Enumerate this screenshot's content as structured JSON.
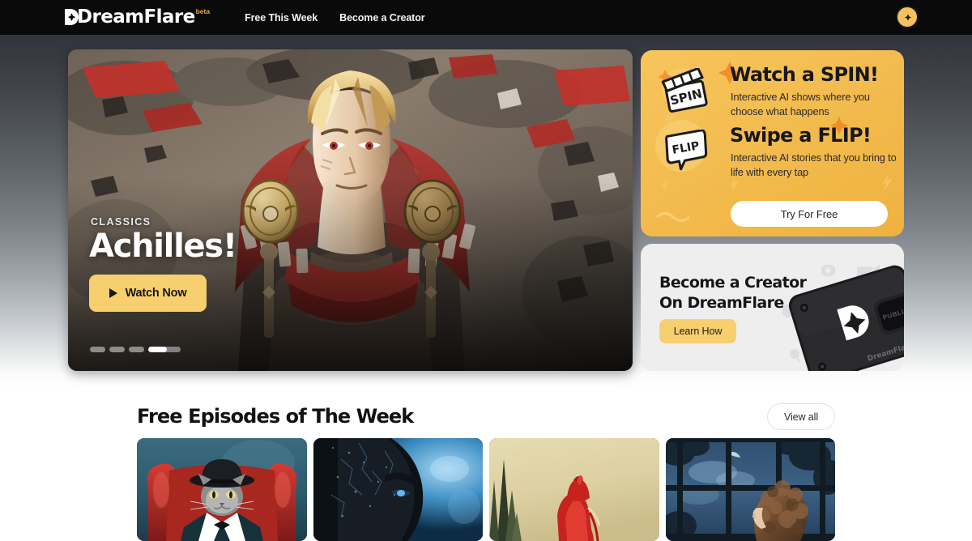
{
  "nav": {
    "logo_text": "DreamFlare",
    "logo_badge": "beta",
    "logo_icon": "dreamflare-flare-icon",
    "links": [
      {
        "label": "Free This Week"
      },
      {
        "label": "Become a Creator"
      }
    ],
    "avatar_icon": "user-avatar-flare-icon"
  },
  "hero": {
    "kicker": "CLASSICS",
    "title": "Achilles!",
    "watch_label": "Watch Now",
    "play_icon": "play-triangle-icon",
    "artwork_alt": "Anime warrior with blonde hair and red cape amid flying debris",
    "carousel": {
      "total": 4,
      "active_index": 4,
      "progress_percent": 57
    }
  },
  "promo": {
    "spin": {
      "icon": "clapperboard-spin-icon",
      "icon_label": "SPIN",
      "heading": "Watch a SPIN!",
      "body": "Interactive AI shows where you choose what happens"
    },
    "flip": {
      "icon": "speech-bubble-flip-icon",
      "icon_label": "FLIP",
      "heading": "Swipe a FLIP!",
      "body": "Interactive AI stories that you bring to life with every tap"
    },
    "cta_label": "Try For Free",
    "bg_color": "#f3bc4f",
    "sparkle_color": "#ef8f2a"
  },
  "creator": {
    "title_line1": "Become a Creator",
    "title_line2": "On DreamFlare",
    "cta_label": "Learn How",
    "device_logo_text": "DreamFlare",
    "device_button_text": "PUBLISH",
    "bg_color": "#eeeeef",
    "cta_color": "#f8cf6e"
  },
  "free_episodes": {
    "title": "Free Episodes of The Week",
    "view_all_label": "View all",
    "cards": [
      {
        "alt": "Cat in tuxedo and bowler hat on red velvet armchair"
      },
      {
        "alt": "Dark cracked stone creature face against blue light"
      },
      {
        "alt": "Figure in red hooded cloak against beige sky with dark spires"
      },
      {
        "alt": "Curly haired figure looking out a window at a moonlit night"
      }
    ]
  },
  "theme": {
    "accent": "#f8cf6e",
    "topbar": "#0a0a0a",
    "page_bg_top": "#2b2f33",
    "page_bg_bottom": "#ffffff"
  }
}
